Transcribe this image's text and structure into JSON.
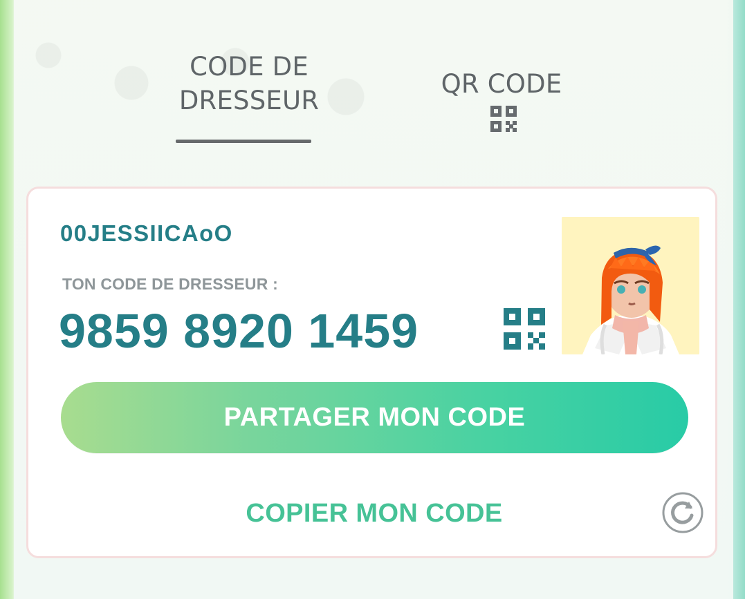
{
  "tabs": {
    "trainer_code_line1": "CODE DE",
    "trainer_code_line2": "DRESSEUR",
    "qr_code": "QR CODE"
  },
  "card": {
    "username": "00JESSIICAoO",
    "code_label": "TON CODE DE DRESSEUR :",
    "trainer_code": "9859 8920 1459",
    "share_button": "PARTAGER MON CODE",
    "copy_button": "COPIER MON CODE"
  },
  "icons": {
    "tab_qr": "qr-code-icon",
    "main_qr": "qr-code-icon",
    "refresh": "refresh-icon"
  },
  "colors": {
    "primary_text": "#257e87",
    "secondary_text": "#8e9699",
    "accent_green": "#46c296",
    "button_gradient_start": "#a8dc8f",
    "button_gradient_end": "#28cba6",
    "avatar_background": "#fff4bf"
  }
}
